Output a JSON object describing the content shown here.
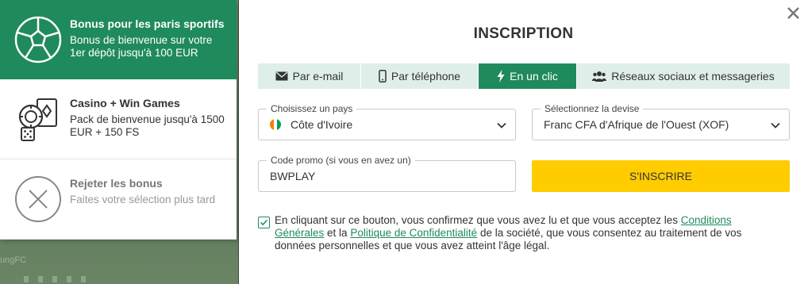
{
  "background": {
    "fragment_text": "ungFC"
  },
  "bonus_panel": {
    "items": [
      {
        "title": "Bonus pour les paris sportifs",
        "desc": "Bonus de bienvenue sur votre 1er dépôt jusqu'à 100 EUR",
        "icon": "soccer-ball-icon",
        "active": true
      },
      {
        "title": "Casino + Win Games",
        "desc": "Pack de bienvenue jusqu'à 1500 EUR + 150 FS",
        "icon": "casino-chips-cards-icon",
        "active": false
      },
      {
        "title": "Rejeter les bonus",
        "desc": "Faites votre sélection plus tard",
        "icon": "reject-x-icon",
        "active": false
      }
    ]
  },
  "modal": {
    "title": "INSCRIPTION",
    "close_icon": "close-icon",
    "tabs": [
      {
        "label": "Par e-mail",
        "icon": "envelope-icon",
        "active": false
      },
      {
        "label": "Par téléphone",
        "icon": "phone-icon",
        "active": false
      },
      {
        "label": "En un clic",
        "icon": "lightning-icon",
        "active": true
      },
      {
        "label": "Réseaux sociaux et messageries",
        "icon": "users-icon",
        "active": false
      }
    ],
    "country": {
      "label": "Choisissez un pays",
      "value": "Côte d'Ivoire",
      "flag_colors": [
        "#f77f00",
        "#ffffff",
        "#009e60"
      ]
    },
    "currency": {
      "label": "Sélectionnez la devise",
      "value": "Franc CFA d'Afrique de l'Ouest (XOF)"
    },
    "promo": {
      "label": "Code promo (si vous en avez un)",
      "value": "BWPLAY"
    },
    "register_label": "S'INSCRIRE",
    "consent": {
      "checked": true,
      "text_before": "En cliquant sur ce bouton, vous confirmez que vous avez lu et que vous acceptez les ",
      "link1": "Conditions Générales",
      "text_middle": " et la ",
      "link2": "Politique de Confidentialité",
      "text_after": " de la société, que vous consentez au traitement de vos données personnelles et que vous avez atteint l'âge légal."
    }
  },
  "colors": {
    "primary_green": "#1f8a5c",
    "tab_bg": "#dfeee8",
    "cta_yellow": "#ffcc00"
  }
}
